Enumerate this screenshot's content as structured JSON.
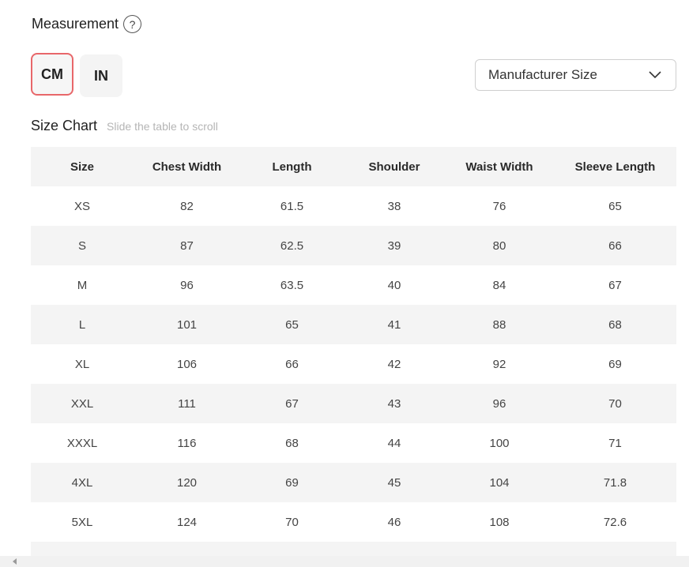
{
  "measurement": {
    "title": "Measurement",
    "help_glyph": "?"
  },
  "units": {
    "options": [
      "CM",
      "IN"
    ],
    "selected": "CM"
  },
  "size_select": {
    "value": "Manufacturer Size"
  },
  "size_chart": {
    "title": "Size Chart",
    "hint": "Slide the table to scroll",
    "columns": [
      "Size",
      "Chest Width",
      "Length",
      "Shoulder",
      "Waist Width",
      "Sleeve Length"
    ],
    "rows": [
      [
        "XS",
        "82",
        "61.5",
        "38",
        "76",
        "65"
      ],
      [
        "S",
        "87",
        "62.5",
        "39",
        "80",
        "66"
      ],
      [
        "M",
        "96",
        "63.5",
        "40",
        "84",
        "67"
      ],
      [
        "L",
        "101",
        "65",
        "41",
        "88",
        "68"
      ],
      [
        "XL",
        "106",
        "66",
        "42",
        "92",
        "69"
      ],
      [
        "XXL",
        "111",
        "67",
        "43",
        "96",
        "70"
      ],
      [
        "XXXL",
        "116",
        "68",
        "44",
        "100",
        "71"
      ],
      [
        "4XL",
        "120",
        "69",
        "45",
        "104",
        "71.8"
      ],
      [
        "5XL",
        "124",
        "70",
        "46",
        "108",
        "72.6"
      ],
      [
        "",
        "",
        "",
        "",
        "",
        ""
      ]
    ]
  },
  "colors": {
    "active_border": "#e8676a",
    "row_stripe": "#f4f4f4"
  }
}
